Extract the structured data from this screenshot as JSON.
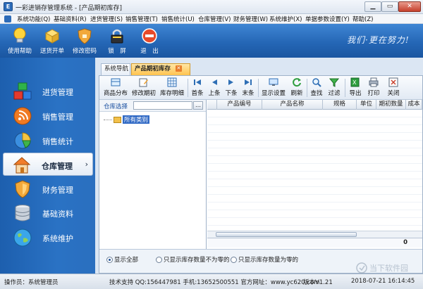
{
  "window": {
    "title": "一彩进销存管理系统 - [产品期初库存]",
    "min_label": "▁",
    "max_label": "▭",
    "close_label": "✕"
  },
  "menubar": {
    "items": [
      "系统功能(Q)",
      "基础资料(R)",
      "进货管理(S)",
      "销售管理(T)",
      "销售统计(U)",
      "仓库管理(V)",
      "财务管理(W)",
      "系统维护(X)",
      "单据参数设置(Y)",
      "帮助(Z)"
    ]
  },
  "header": {
    "buttons": [
      {
        "label": "使用帮助",
        "icon": "lightbulb-icon"
      },
      {
        "label": "送货开单",
        "icon": "delivery-box-icon"
      },
      {
        "label": "修改密码",
        "icon": "shield-key-icon"
      },
      {
        "label": "锁　屏",
        "icon": "lock-icon"
      },
      {
        "label": "退　出",
        "icon": "exit-icon"
      }
    ],
    "slogan": "我们·更在努力!"
  },
  "leftnav": {
    "items": [
      {
        "label": "进货管理",
        "icon": "purchase-blocks-icon"
      },
      {
        "label": "销售管理",
        "icon": "rss-sales-icon"
      },
      {
        "label": "销售统计",
        "icon": "pie-chart-icon"
      },
      {
        "label": "仓库管理",
        "icon": "warehouse-house-icon"
      },
      {
        "label": "财务管理",
        "icon": "finance-shield-icon"
      },
      {
        "label": "基础资料",
        "icon": "database-icon"
      },
      {
        "label": "系统维护",
        "icon": "globe-icon"
      }
    ],
    "active_index": 3,
    "active_chevron": "›"
  },
  "tabs": [
    {
      "label": "系统导航",
      "active": false
    },
    {
      "label": "产品期初库存",
      "active": true,
      "close": "✕"
    }
  ],
  "toolbar": {
    "buttons": [
      {
        "label": "商品分布",
        "icon": "product-distribution-icon"
      },
      {
        "label": "修改期初",
        "icon": "edit-opening-icon"
      },
      {
        "label": "库存明细",
        "icon": "stock-detail-icon"
      },
      {
        "label": "首条",
        "icon": "first-record-icon"
      },
      {
        "label": "上条",
        "icon": "prev-record-icon"
      },
      {
        "label": "下条",
        "icon": "next-record-icon"
      },
      {
        "label": "末条",
        "icon": "last-record-icon"
      },
      {
        "label": "显示设置",
        "icon": "display-settings-icon"
      },
      {
        "label": "刷新",
        "icon": "refresh-icon"
      },
      {
        "label": "查找",
        "icon": "find-icon"
      },
      {
        "label": "过滤",
        "icon": "filter-icon"
      },
      {
        "label": "导出",
        "icon": "export-icon"
      },
      {
        "label": "打印",
        "icon": "print-icon"
      },
      {
        "label": "关闭",
        "icon": "close-window-icon"
      }
    ]
  },
  "tree": {
    "header_label": "仓库选择",
    "browse_label": "…",
    "root_node": "所有类别"
  },
  "grid": {
    "columns": [
      "",
      "产品编号",
      "产品名称",
      "规格",
      "单位",
      "期初数量",
      "成本"
    ],
    "total": "0"
  },
  "filters": {
    "options": [
      {
        "label": "显示全部",
        "selected": true
      },
      {
        "label": "只显示库存数量不为零的",
        "selected": false
      },
      {
        "label": "只显示库存数量为零的",
        "selected": false
      }
    ]
  },
  "statusbar": {
    "operator": "操作员：系统管理员",
    "support": "技术支持 QQ:156447981 手机:13652500551 官方网址：www.yc620.com",
    "version": "版本V1.21",
    "datetime": "2018-07-21 16:14:45"
  },
  "watermark": {
    "text": "当下软件园"
  },
  "colors": {
    "header_blue": "#2567b6",
    "nav_blue": "#2a72c4",
    "active_tab": "#ffc34f",
    "selection": "#316ac5"
  }
}
